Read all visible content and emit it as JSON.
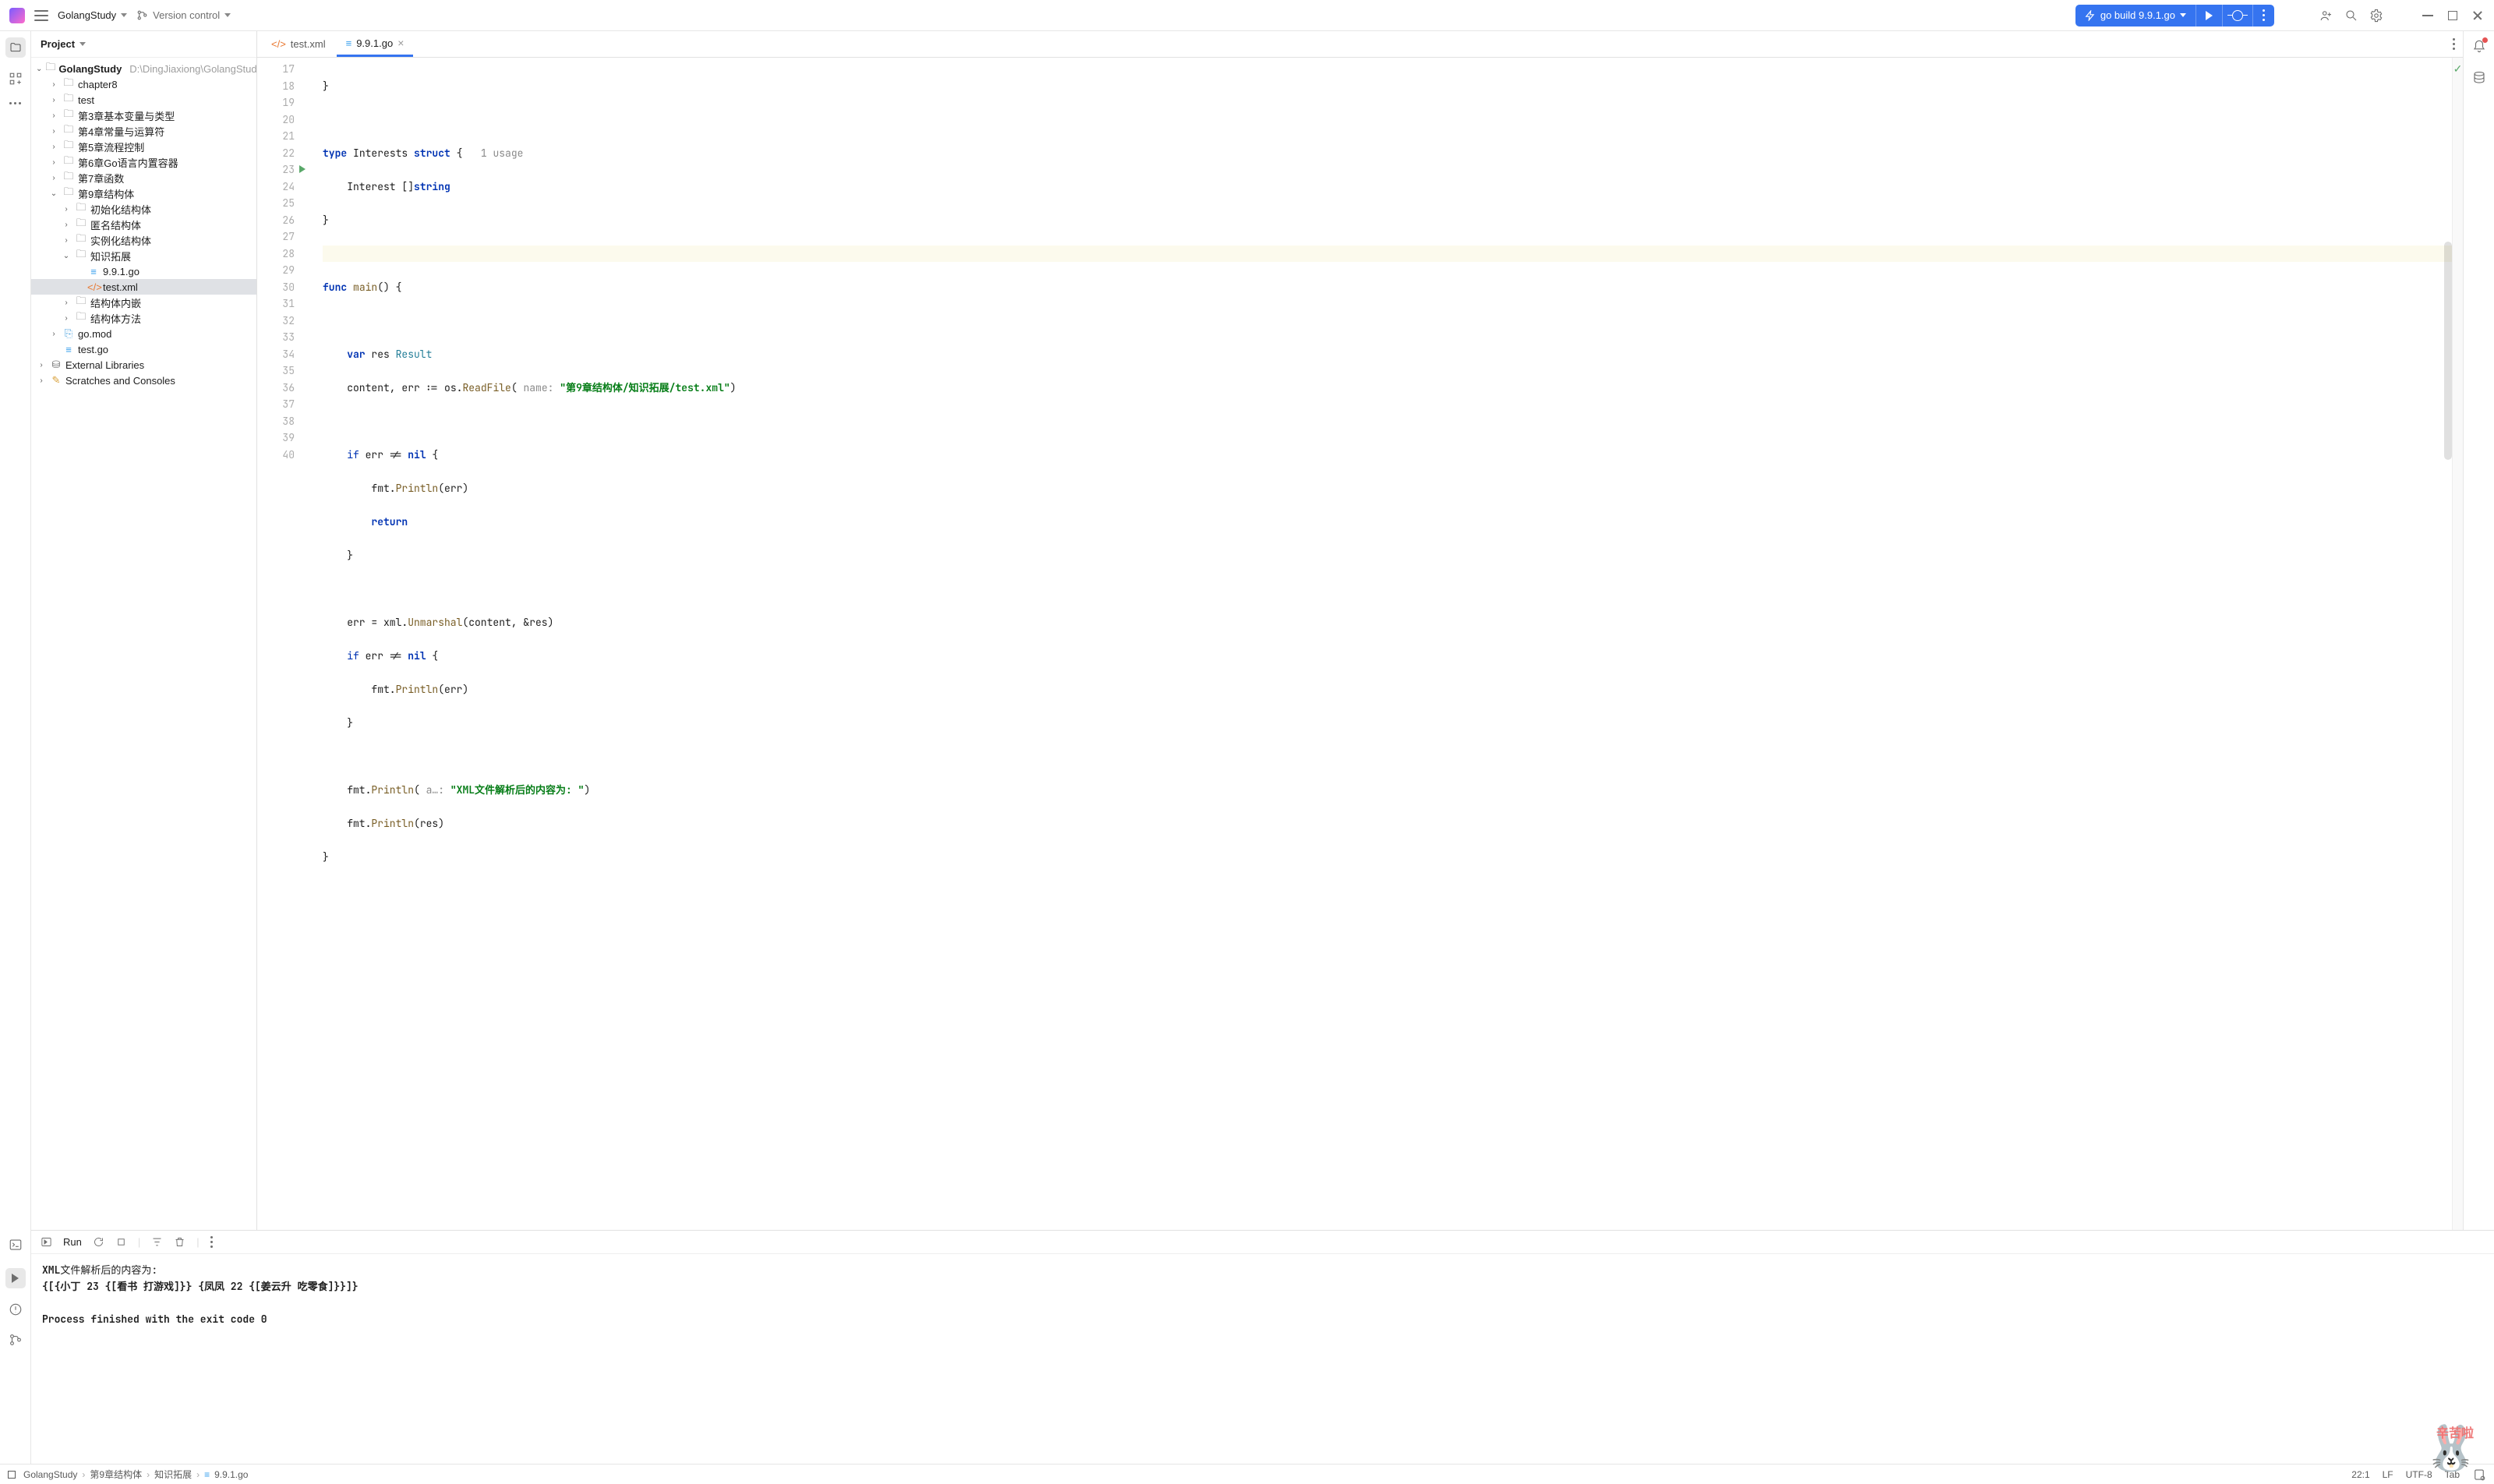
{
  "toolbar": {
    "project_name": "GolangStudy",
    "vcs_label": "Version control",
    "run_config": "go build 9.9.1.go"
  },
  "project_panel": {
    "title": "Project"
  },
  "tree": {
    "root_label": "GolangStudy",
    "root_path": "D:\\DingJiaxiong\\GolangStudy",
    "items": [
      "chapter8",
      "test",
      "第3章基本变量与类型",
      "第4章常量与运算符",
      "第5章流程控制",
      "第6章Go语言内置容器",
      "第7章函数"
    ],
    "struct_root": "第9章结构体",
    "struct_children": [
      "初始化结构体",
      "匿名结构体",
      "实例化结构体"
    ],
    "knowledge": "知识拓展",
    "knowledge_children": [
      "9.9.1.go",
      "test.xml"
    ],
    "struct_tail": [
      "结构体内嵌",
      "结构体方法"
    ],
    "go_mod": "go.mod",
    "test_go": "test.go",
    "ext_lib": "External Libraries",
    "scratches": "Scratches and Consoles"
  },
  "tabs": {
    "tab1": "test.xml",
    "tab2": "9.9.1.go"
  },
  "code": {
    "usage_hint": "1 usage",
    "name_hint": "name:",
    "a_hint": "a…:",
    "l17": "}",
    "l19_pre": "type ",
    "l19_name": "Interests ",
    "l19_kw": "struct ",
    "l19_brace": "{",
    "l20": "    Interest []",
    "l20_str": "string",
    "l21": "}",
    "l23_pre": "func ",
    "l23_main": "main",
    "l23_rest": "() {",
    "l25_pre": "    var ",
    "l25_res": "res ",
    "l25_typ": "Result",
    "l26_a": "    content, err := ",
    "l26_os": "os",
    "l26_dot": ".",
    "l26_rf": "ReadFile",
    "l26_paren": "( ",
    "l26_str": "\"第9章结构体/知识拓展/test.xml\"",
    "l26_end": ")",
    "l28": "    if err != ",
    "l28_nil": "nil ",
    "l28_b": "{",
    "l29_a": "        fmt.",
    "l29_fn": "Println",
    "l29_b": "(err)",
    "l30": "        return",
    "l31": "    }",
    "l33_a": "    err = xml.",
    "l33_fn": "Unmarshal",
    "l33_b": "(content, &res)",
    "l34": "    if err != ",
    "l34_nil": "nil ",
    "l34_b": "{",
    "l35_a": "        fmt.",
    "l35_fn": "Println",
    "l35_b": "(err)",
    "l36": "    }",
    "l38_a": "    fmt.",
    "l38_fn": "Println",
    "l38_b": "( ",
    "l38_str": "\"XML文件解析后的内容为: \"",
    "l38_end": ")",
    "l39_a": "    fmt.",
    "l39_fn": "Println",
    "l39_b": "(res)",
    "l40": "}"
  },
  "run": {
    "label": "Run",
    "out1": "XML文件解析后的内容为:",
    "out2": "{[{小丁 23 {[看书 打游戏]}} {凤凤 22 {[姜云升 吃零食]}}]}",
    "exit": "Process finished with the exit code 0"
  },
  "cartoon_text": "辛苦啦",
  "breadcrumbs": [
    "GolangStudy",
    "第9章结构体",
    "知识拓展",
    "9.9.1.go"
  ],
  "status": {
    "pos": "22:1",
    "sep1": "LF",
    "enc": "UTF-8",
    "indent": "Tab"
  }
}
